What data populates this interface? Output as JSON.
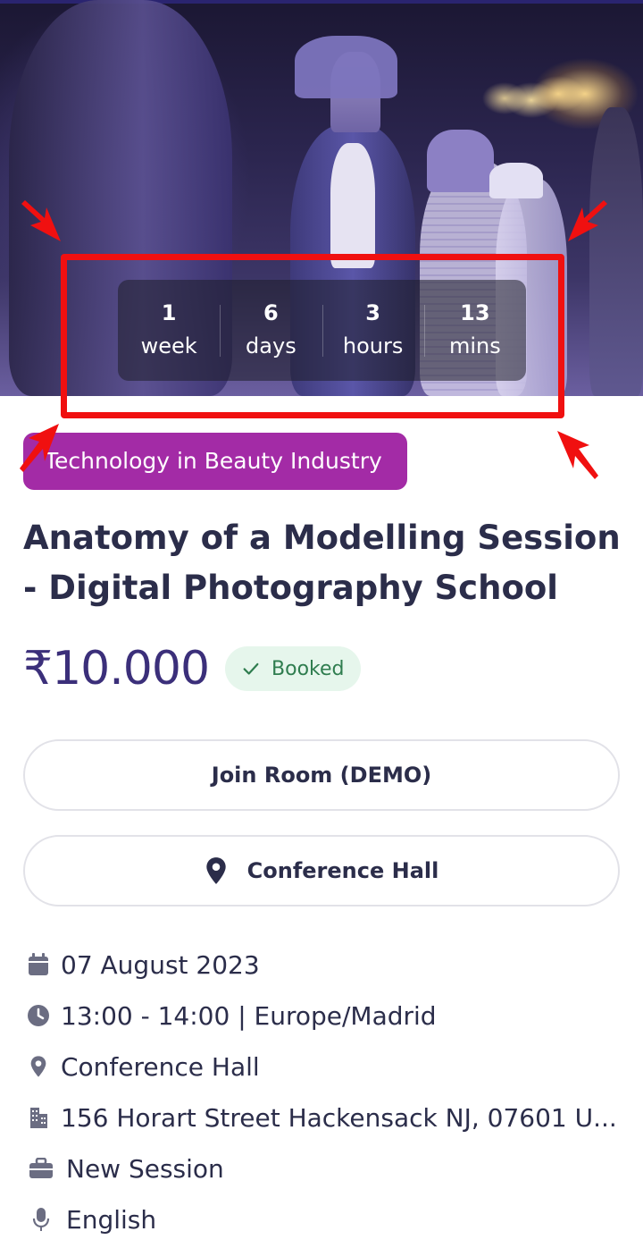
{
  "hero": {
    "image_alt": "fashion-runway-photo"
  },
  "countdown": [
    {
      "value": "1",
      "unit": "week"
    },
    {
      "value": "6",
      "unit": "days"
    },
    {
      "value": "3",
      "unit": "hours"
    },
    {
      "value": "13",
      "unit": "mins"
    }
  ],
  "category": "Technology in Beauty Industry",
  "event": {
    "title": "Anatomy of a Modelling Session - Digital Photography School",
    "price": "₹10.000",
    "status": "Booked"
  },
  "buttons": {
    "join_room": "Join Room (DEMO)",
    "location": "Conference Hall"
  },
  "details": {
    "date": "07 August 2023",
    "time": "13:00 - 14:00 | Europe/Madrid",
    "venue": "Conference Hall",
    "address": "156 Horart Street Hackensack NJ, 07601 U...",
    "session_type": "New Session",
    "language": "English"
  },
  "icons": {
    "date": "calendar-icon",
    "time": "clock-icon",
    "venue": "map-pin-icon",
    "address": "building-icon",
    "session_type": "briefcase-icon",
    "language": "microphone-icon",
    "location_button": "map-pin-icon",
    "booked": "check-icon"
  },
  "colors": {
    "category_pill": "#a32ba6",
    "price": "#3b2f7a",
    "booked_bg": "#e6f6ec",
    "booked_text": "#2f7d4f",
    "annotation": "#f01010",
    "icon": "#6b6d82"
  }
}
